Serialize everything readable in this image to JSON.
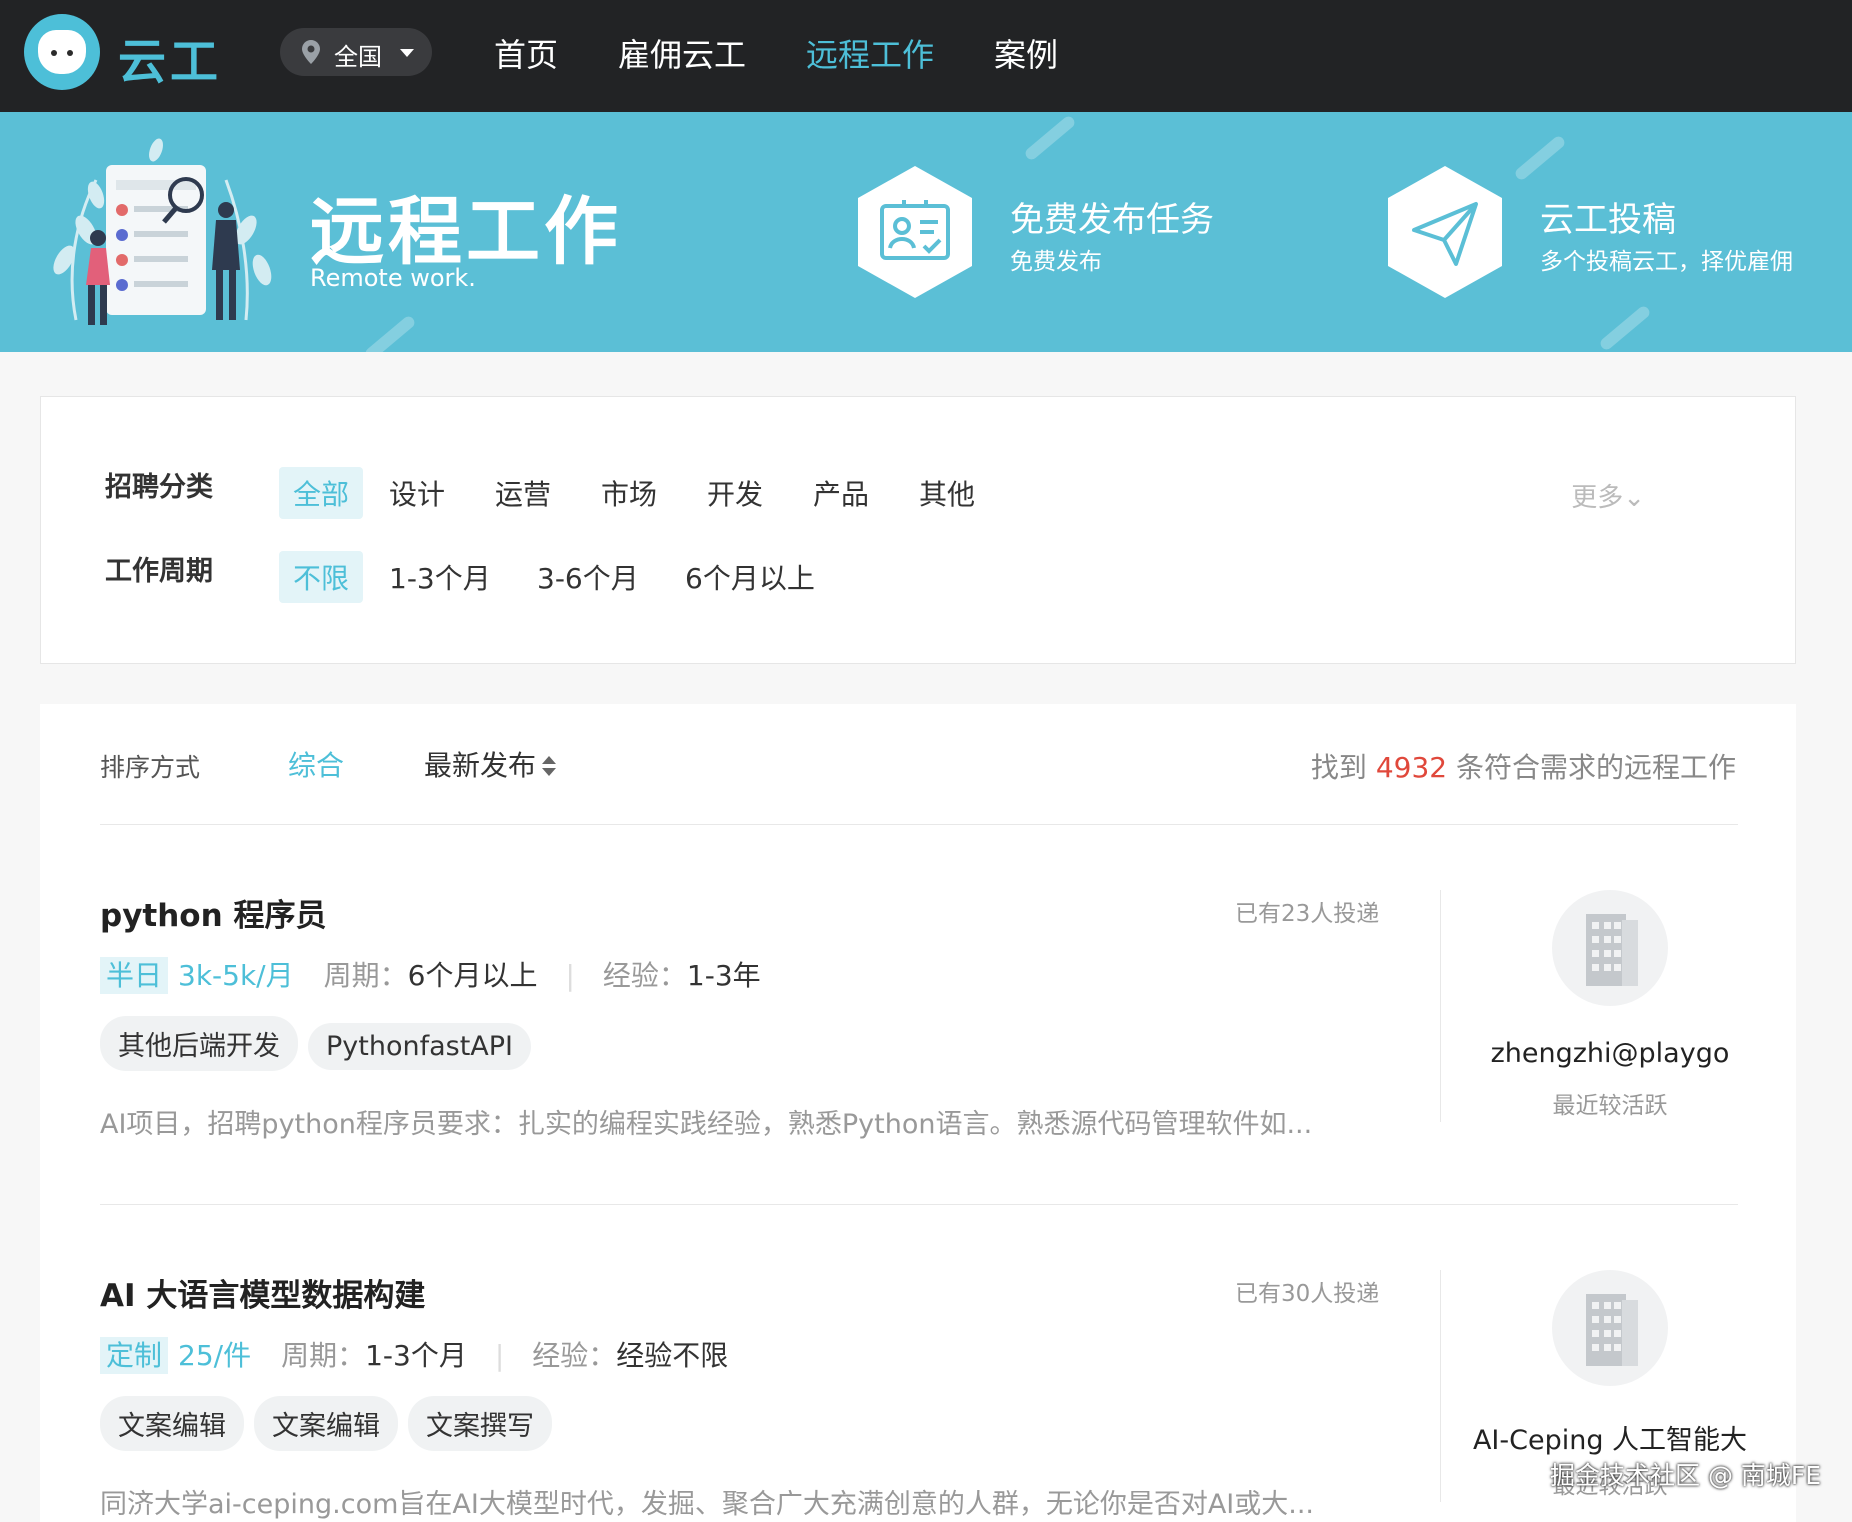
{
  "nav": {
    "logo_text": "云工",
    "region": "全国",
    "items": [
      "首页",
      "雇佣云工",
      "远程工作",
      "案例"
    ],
    "active_index": 2
  },
  "banner": {
    "title": "远程工作",
    "subtitle": "Remote work.",
    "features": [
      {
        "title": "免费发布任务",
        "subtitle": "免费发布",
        "icon": "id-card-icon"
      },
      {
        "title": "云工投稿",
        "subtitle": "多个投稿云工，择优雇佣",
        "icon": "paper-plane-icon"
      }
    ]
  },
  "filters": {
    "category_label": "招聘分类",
    "categories": [
      "全部",
      "设计",
      "运营",
      "市场",
      "开发",
      "产品",
      "其他"
    ],
    "more": "更多",
    "period_label": "工作周期",
    "periods": [
      "不限",
      "1-3个月",
      "3-6个月",
      "6个月以上"
    ]
  },
  "sort": {
    "label": "排序方式",
    "options": [
      "综合",
      "最新发布"
    ],
    "found_prefix": "找到",
    "found_count": "4932",
    "found_suffix": "条符合需求的远程工作"
  },
  "jobs": [
    {
      "title": "python 程序员",
      "applied": "已有23人投递",
      "type": "半日",
      "price": "3k-5k/月",
      "period_key": "周期：",
      "period": "6个月以上",
      "exp_key": "经验：",
      "exp": "1-3年",
      "tags": [
        "其他后端开发",
        "PythonfastAPI"
      ],
      "desc": "AI项目，招聘python程序员要求：扎实的编程实践经验，熟悉Python语言。熟悉源代码管理软件如...",
      "company": "zhengzhi@playgo",
      "status": "最近较活跃"
    },
    {
      "title": "AI 大语言模型数据构建",
      "applied": "已有30人投递",
      "type": "定制",
      "price": "25/件",
      "period_key": "周期：",
      "period": "1-3个月",
      "exp_key": "经验：",
      "exp": "经验不限",
      "tags": [
        "文案编辑",
        "文案编辑",
        "文案撰写"
      ],
      "desc": "同济大学ai-ceping.com旨在AI大模型时代，发掘、聚合广大充满创意的人群，无论你是否对AI或大...",
      "company": "AI-Ceping 人工智能大",
      "status": "最近较活跃"
    }
  ],
  "watermark": "掘金技术社区 @ 南城FE",
  "colors": {
    "accent": "#4dbfd8",
    "topbar": "#222325",
    "banner": "#5bbfd6",
    "count": "#e0483b"
  }
}
